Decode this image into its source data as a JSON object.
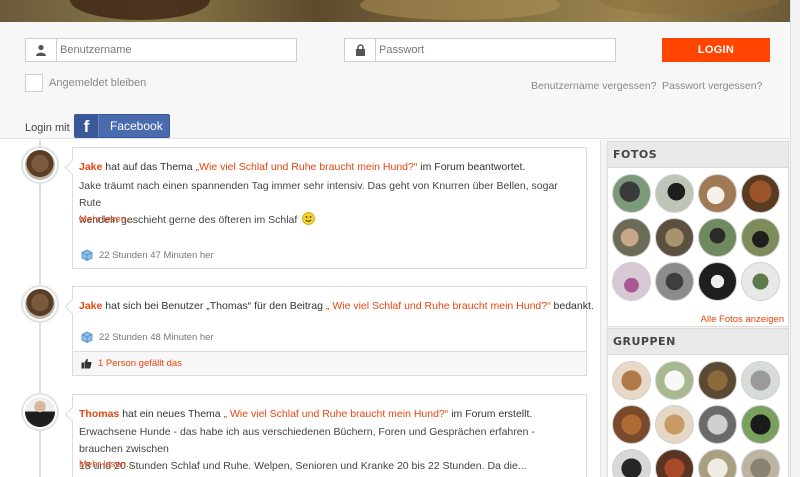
{
  "login": {
    "username_placeholder": "Benutzername",
    "password_placeholder": "Passwort",
    "login_button": "LOGIN",
    "remember_label": "Angemeldet bleiben",
    "forgot_username": "Benutzername vergessen?",
    "forgot_password": "Passwort vergessen?",
    "login_with": "Login mit",
    "facebook_label": "Facebook"
  },
  "feed": [
    {
      "user": "Jake",
      "action_before": "hat auf das Thema",
      "link": "„Wie viel Schlaf und Ruhe braucht mein Hund?“",
      "action_after": "im Forum beantwortet.",
      "body_line1": "Jake träumt nach einen spannenden Tag immer sehr intensiv. Das geht von Knurren über Bellen, sogar Rute",
      "body_line2": "wendeln geschieht gerne des öfteren im Schlaf",
      "more": "Mehr lesen...",
      "time": "22 Stunden 47 Minuten her"
    },
    {
      "user": "Jake",
      "action_before": "hat sich bei Benutzer „Thomas“ für den Beitrag",
      "link": "„ Wie viel Schlaf und Ruhe braucht mein Hund?“",
      "action_after": "bedankt.",
      "time": "22 Stunden 48 Minuten her",
      "likes": "1 Person gefällt das"
    },
    {
      "user": "Thomas",
      "action_before": "hat ein neues Thema",
      "link": "„ Wie viel Schlaf und Ruhe braucht mein Hund?“",
      "action_after": "im Forum erstellt.",
      "body_line1": "Erwachsene Hunde - das habe ich aus verschiedenen Büchern, Foren und Gesprächen erfahren - brauchen zwischen",
      "body_line2": "18 und 20 Stunden Schlaf und Ruhe. Welpen, Senioren und Kranke 20 bis 22 Stunden. Da die...",
      "more": "Mehr lesen..."
    }
  ],
  "sidebar": {
    "photos_title": "FOTOS",
    "photos_link": "Alle Fotos anzeigen",
    "groups_title": "GRUPPEN"
  },
  "colors": {
    "accent": "#ff4500",
    "link": "#e8450f",
    "facebook": "#3b5998"
  }
}
